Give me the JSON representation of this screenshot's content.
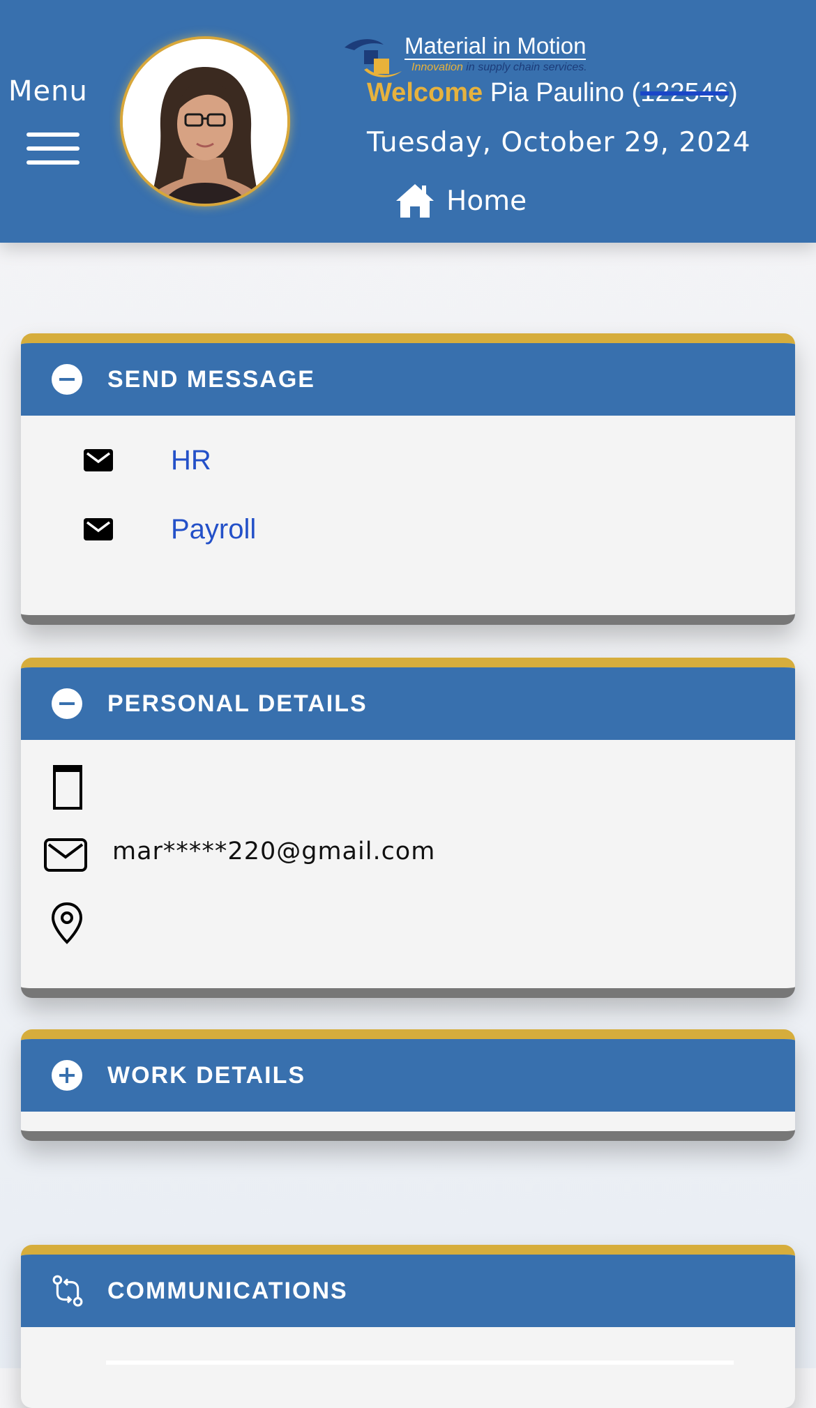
{
  "header": {
    "menu_label": "Menu",
    "logo": {
      "title": "Material in Motion",
      "tagline_part1": "Innovation",
      "tagline_part2": " in supply chain services."
    },
    "welcome": {
      "label": "Welcome",
      "name": "Pia Paulino",
      "employee_id": "122546"
    },
    "date": "Tuesday, October 29, 2024",
    "home_label": "Home",
    "icons": [
      "hamburger-icon",
      "home-icon"
    ],
    "colors": {
      "primary": "#3870ae",
      "accent": "#d6ad3c",
      "link": "#2350c8"
    }
  },
  "send_message": {
    "title": "SEND MESSAGE",
    "items": [
      {
        "label": "HR",
        "icon": "envelope-icon"
      },
      {
        "label": "Payroll",
        "icon": "envelope-icon"
      }
    ]
  },
  "personal_details": {
    "title": "PERSONAL DETAILS",
    "phone": "",
    "email": "mar*****220@gmail.com",
    "address": ""
  },
  "work_details": {
    "title": "WORK DETAILS"
  },
  "communications": {
    "title": "COMMUNICATIONS"
  }
}
